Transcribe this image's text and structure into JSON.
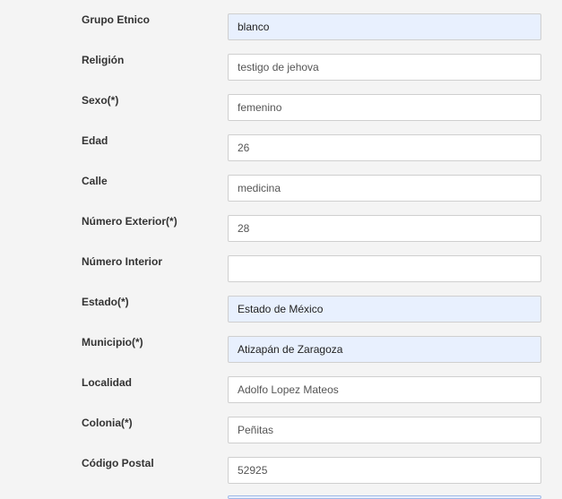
{
  "fields": [
    {
      "label": "Grupo Etnico",
      "value": "blanco",
      "autofill": true
    },
    {
      "label": "Religión",
      "value": "testigo de jehova",
      "autofill": false
    },
    {
      "label": "Sexo(*)",
      "value": "femenino",
      "autofill": false
    },
    {
      "label": "Edad",
      "value": "26",
      "autofill": false
    },
    {
      "label": "Calle",
      "value": "medicina",
      "autofill": false
    },
    {
      "label": "Número Exterior(*)",
      "value": "28",
      "autofill": false
    },
    {
      "label": "Número Interior",
      "value": "",
      "autofill": false
    },
    {
      "label": "Estado(*)",
      "value": "Estado de México",
      "autofill": true
    },
    {
      "label": "Municipio(*)",
      "value": "Atizapán de Zaragoza",
      "autofill": true
    },
    {
      "label": "Localidad",
      "value": "Adolfo Lopez Mateos",
      "autofill": false
    },
    {
      "label": "Colonia(*)",
      "value": "Peñitas",
      "autofill": false
    },
    {
      "label": "Código Postal",
      "value": "52925",
      "autofill": false
    }
  ],
  "colors": {
    "autofill_bg": "#e8f0fe",
    "field_border": "#cfcfcf",
    "page_bg": "#f4f4f4"
  }
}
